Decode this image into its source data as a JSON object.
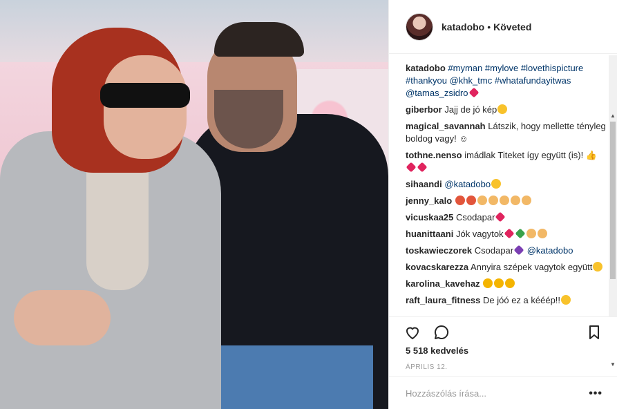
{
  "post": {
    "username": "katadobo",
    "follow_status": "Követed"
  },
  "caption": {
    "username": "katadobo",
    "hashtags": "#myman #mylove #lovethispicture #thankyou @khk_tmc #whatafundayitwas @tamas_zsidro"
  },
  "comments": [
    {
      "user": "giberbor",
      "text": "Jajj de jó kép",
      "emoji": [
        "face"
      ]
    },
    {
      "user": "magical_savannah",
      "text": "Látszik, hogy mellette tényleg boldog vagy! ☺",
      "emoji": []
    },
    {
      "user": "tothne.nenso",
      "text": "imádlak Titeket így együtt (is)! 👍",
      "emoji": [
        "heart",
        "heart"
      ]
    },
    {
      "user": "sihaandi",
      "text": "@katadobo",
      "emoji": [
        "face"
      ]
    },
    {
      "user": "jenny_kalo",
      "text": "",
      "emoji": [
        "burst",
        "burst",
        "ok",
        "ok",
        "ok",
        "ok",
        "ok"
      ]
    },
    {
      "user": "vicuskaa25",
      "text": "Csodapar",
      "emoji": [
        "heart"
      ]
    },
    {
      "user": "huanittaani",
      "text": "Jók vagytok",
      "emoji": [
        "heart",
        "green",
        "ok",
        "ok"
      ]
    },
    {
      "user": "toskawieczorek",
      "text": "Csodapar",
      "mention": "@katadobo",
      "emoji": [
        "purple"
      ]
    },
    {
      "user": "kovacskarezza",
      "text": "Annyira szépek vagytok együtt",
      "emoji": [
        "face"
      ]
    },
    {
      "user": "karolina_kavehaz",
      "text": "",
      "emoji": [
        "star",
        "star",
        "star"
      ]
    },
    {
      "user": "raft_laura_fitness",
      "text": "De jóó ez a kééép!!",
      "emoji": [
        "face"
      ]
    }
  ],
  "stats": {
    "likes": "5 518 kedvelés",
    "date": "ÁPRILIS 12."
  },
  "add_comment": {
    "placeholder": "Hozzászólás írása..."
  },
  "icons": {
    "like": "heart-outline-icon",
    "comment": "speech-bubble-icon",
    "save": "bookmark-icon",
    "more": "more-options-icon"
  },
  "colors": {
    "link": "#003569",
    "text": "#262626",
    "muted": "#999999",
    "border": "#efefef"
  }
}
